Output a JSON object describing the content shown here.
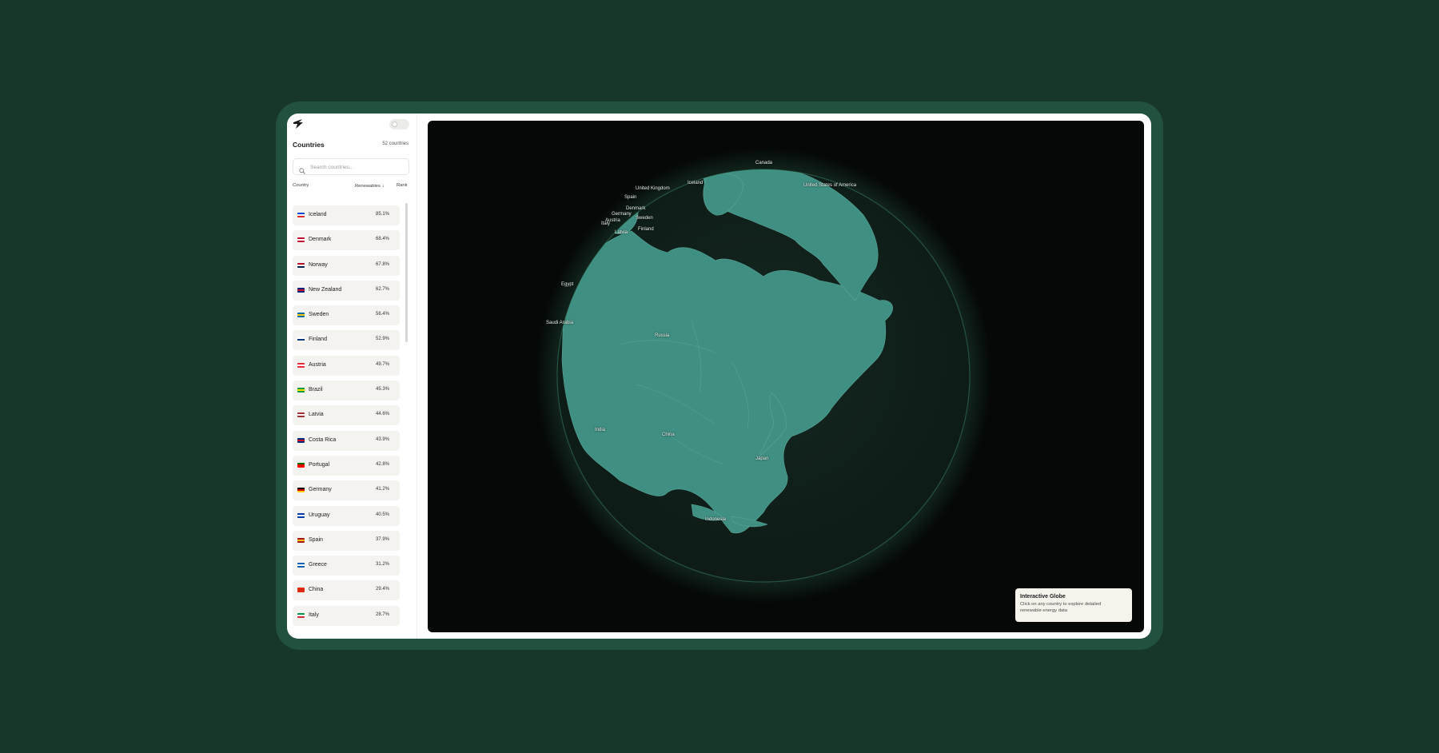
{
  "sidebar": {
    "title": "Countries",
    "count": "52 countries",
    "search_placeholder": "Search countries...",
    "columns": {
      "country": "Country",
      "renewables": "Renewables",
      "sort_arrow": "↓",
      "rank": "Rank"
    },
    "rows": [
      {
        "name": "Iceland",
        "value": "85.1%",
        "flag": [
          "#0048e0",
          "#ffffff",
          "#d72828"
        ]
      },
      {
        "name": "Denmark",
        "value": "68.4%",
        "flag": [
          "#c60c30",
          "#ffffff",
          "#c60c30"
        ]
      },
      {
        "name": "Norway",
        "value": "67.8%",
        "flag": [
          "#ba0c2f",
          "#ffffff",
          "#00205b"
        ]
      },
      {
        "name": "New Zealand",
        "value": "62.7%",
        "flag": [
          "#00247d",
          "#cc142b",
          "#00247d"
        ]
      },
      {
        "name": "Sweden",
        "value": "56.4%",
        "flag": [
          "#006aa7",
          "#fecc00",
          "#006aa7"
        ]
      },
      {
        "name": "Finland",
        "value": "52.9%",
        "flag": [
          "#ffffff",
          "#003580",
          "#ffffff"
        ]
      },
      {
        "name": "Austria",
        "value": "49.7%",
        "flag": [
          "#ed2939",
          "#ffffff",
          "#ed2939"
        ]
      },
      {
        "name": "Brazil",
        "value": "45.3%",
        "flag": [
          "#009c3b",
          "#ffdf00",
          "#009c3b"
        ]
      },
      {
        "name": "Latvia",
        "value": "44.6%",
        "flag": [
          "#9e3039",
          "#ffffff",
          "#9e3039"
        ]
      },
      {
        "name": "Costa Rica",
        "value": "43.9%",
        "flag": [
          "#002b7f",
          "#ce1126",
          "#002b7f"
        ]
      },
      {
        "name": "Portugal",
        "value": "42.8%",
        "flag": [
          "#006600",
          "#ff0000",
          "#ff0000"
        ]
      },
      {
        "name": "Germany",
        "value": "41.2%",
        "flag": [
          "#000000",
          "#dd0000",
          "#ffce00"
        ]
      },
      {
        "name": "Uruguay",
        "value": "40.5%",
        "flag": [
          "#0038a8",
          "#ffffff",
          "#0038a8"
        ]
      },
      {
        "name": "Spain",
        "value": "37.9%",
        "flag": [
          "#aa151b",
          "#f1bf00",
          "#aa151b"
        ]
      },
      {
        "name": "Greece",
        "value": "31.2%",
        "flag": [
          "#0d5eaf",
          "#ffffff",
          "#0d5eaf"
        ]
      },
      {
        "name": "China",
        "value": "29.4%",
        "flag": [
          "#de2910",
          "#de2910",
          "#de2910"
        ]
      },
      {
        "name": "Italy",
        "value": "28.7%",
        "flag": [
          "#009246",
          "#ffffff",
          "#ce2b37"
        ]
      }
    ]
  },
  "globe": {
    "labels": [
      {
        "text": "Canada"
      },
      {
        "text": "United States of America"
      },
      {
        "text": "Iceland"
      },
      {
        "text": "United Kingdom"
      },
      {
        "text": "Spain"
      },
      {
        "text": "Denmark"
      },
      {
        "text": "Germany"
      },
      {
        "text": "Sweden"
      },
      {
        "text": "Austria"
      },
      {
        "text": "Italy"
      },
      {
        "text": "Latvia"
      },
      {
        "text": "Finland"
      },
      {
        "text": "Egypt"
      },
      {
        "text": "Saudi Arabia"
      },
      {
        "text": "Russia"
      },
      {
        "text": "India"
      },
      {
        "text": "China"
      },
      {
        "text": "Japan"
      },
      {
        "text": "Indonesia"
      }
    ]
  },
  "info_card": {
    "title": "Interactive Globe",
    "text": "Click on any country to explore detailed renewable energy data"
  },
  "colors": {
    "background": "#17372b",
    "frame": "#235140",
    "land": "#3f8f82",
    "ocean": "#0f1f1b",
    "accent": "#4caf8c"
  }
}
